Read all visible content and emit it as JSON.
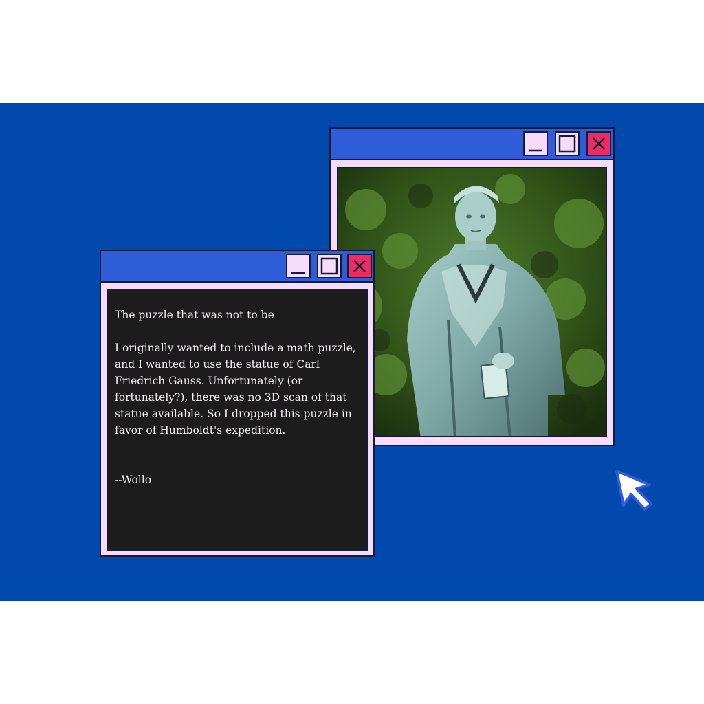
{
  "photo_window": {
    "image_alt": "Statue of Carl Friedrich Gauss",
    "buttons": {
      "minimize_icon": "minimize-icon",
      "maximize_icon": "maximize-icon",
      "close_icon": "close-icon"
    }
  },
  "text_window": {
    "heading": "The puzzle that was not to be",
    "body": "I originally wanted to include a math puzzle, and I wanted to use the statue of Carl Friedrich Gauss. Unfortunately (or fortunately?), there was no 3D scan of that statue available. So I dropped this puzzle in favor of Humboldt's expedition.",
    "signature": "--Wollo",
    "buttons": {
      "minimize_icon": "minimize-icon",
      "maximize_icon": "maximize-icon",
      "close_icon": "close-icon"
    }
  },
  "colors": {
    "desktop": "#0249ae",
    "titlebar": "#2f5cd8",
    "window_frame": "#f6dcf6",
    "close_button": "#ef2b63",
    "text_pane": "#1c1c1c"
  },
  "cursor_icon": "pointer-arrow-icon"
}
